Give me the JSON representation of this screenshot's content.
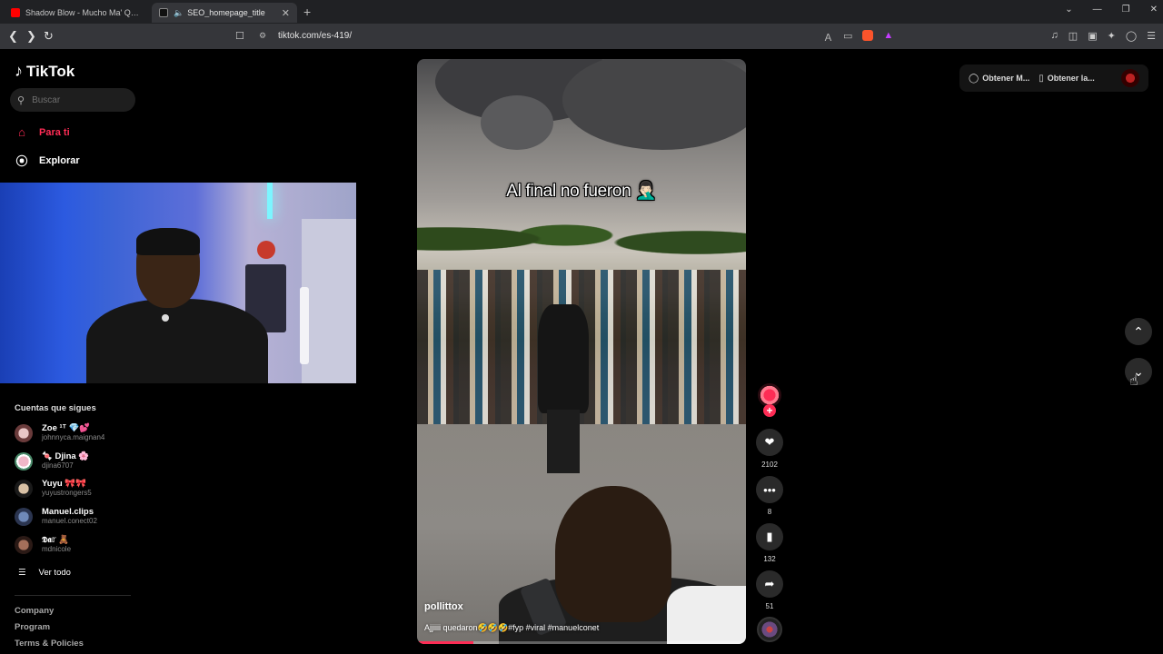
{
  "browser": {
    "tabs": [
      {
        "title": "Shadow Blow - Mucho Ma' Que Enamorado",
        "active": false
      },
      {
        "title": "SEO_homepage_title",
        "active": true
      }
    ],
    "url": "tiktok.com/es-419/"
  },
  "brand": {
    "name": "TikTok",
    "accent": "#fe2c55"
  },
  "search": {
    "placeholder": "Buscar"
  },
  "nav": [
    {
      "label": "Para ti",
      "icon": "home-icon",
      "active": true
    },
    {
      "label": "Explorar",
      "icon": "compass-icon",
      "active": false
    }
  ],
  "following": {
    "title": "Cuentas que sigues",
    "accounts": [
      {
        "display": "Zoe ¹ᵀ 💎💕",
        "username": "johnnyca.maignan4"
      },
      {
        "display": "🍬 Djina 🌸",
        "username": "djina6707"
      },
      {
        "display": "Yuyu 🎀🎀",
        "username": "yuyustrongers5"
      },
      {
        "display": "Manuel.clips",
        "username": "manuel.conect02"
      },
      {
        "display": "𝕯𝖆𝕣 🧸",
        "username": "mdnicole"
      }
    ],
    "see_all": "Ver todo"
  },
  "footer": {
    "links": [
      "Company",
      "Program",
      "Terms & Policies"
    ]
  },
  "video": {
    "overlay_text": "Al final no fueron 🤦🏻‍♂️",
    "author": "pollittox",
    "description": "Ajjiiii quedaron🤣🤣🤣#fyp #viral #manuelconet",
    "progress": 0.17
  },
  "actions": {
    "likes": "2102",
    "comments": "8",
    "saves": "132",
    "shares": "51"
  },
  "top_right": {
    "get_coins": "Obtener M...",
    "get_app": "Obtener la..."
  }
}
